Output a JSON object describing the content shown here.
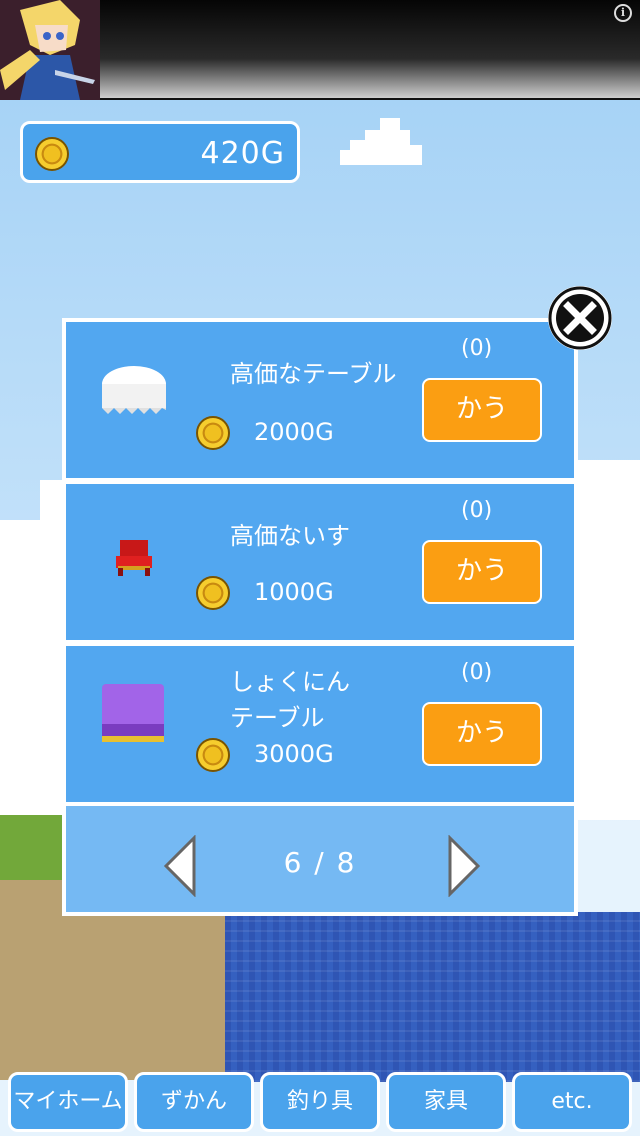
{
  "ad_banner": {
    "info_icon": "info-icon"
  },
  "gold": {
    "amount": "420G",
    "icon": "coin-icon"
  },
  "shop": {
    "close_icon": "close-x-icon",
    "items": [
      {
        "name": "高価なテーブル",
        "price": "2000G",
        "owned": "(0)",
        "buy_label": "かう",
        "icon": "round-table-icon"
      },
      {
        "name": "高価ないす",
        "price": "1000G",
        "owned": "(0)",
        "buy_label": "かう",
        "icon": "red-chair-icon"
      },
      {
        "name": "しょくにん\nテーブル",
        "price": "3000G",
        "owned": "(0)",
        "buy_label": "かう",
        "icon": "purple-table-icon"
      }
    ],
    "pager": {
      "label": "6 / 8",
      "prev_icon": "left-arrow-icon",
      "next_icon": "right-arrow-icon"
    }
  },
  "bottom_nav": {
    "tabs": [
      {
        "label": "マイホーム"
      },
      {
        "label": "ずかん"
      },
      {
        "label": "釣り具"
      },
      {
        "label": "家具"
      },
      {
        "label": "etc."
      }
    ]
  },
  "colors": {
    "panel_blue": "#52a7f0",
    "buy_orange": "#fb9e12",
    "sea_blue": "#3560c0",
    "grass_green": "#72a83a"
  }
}
